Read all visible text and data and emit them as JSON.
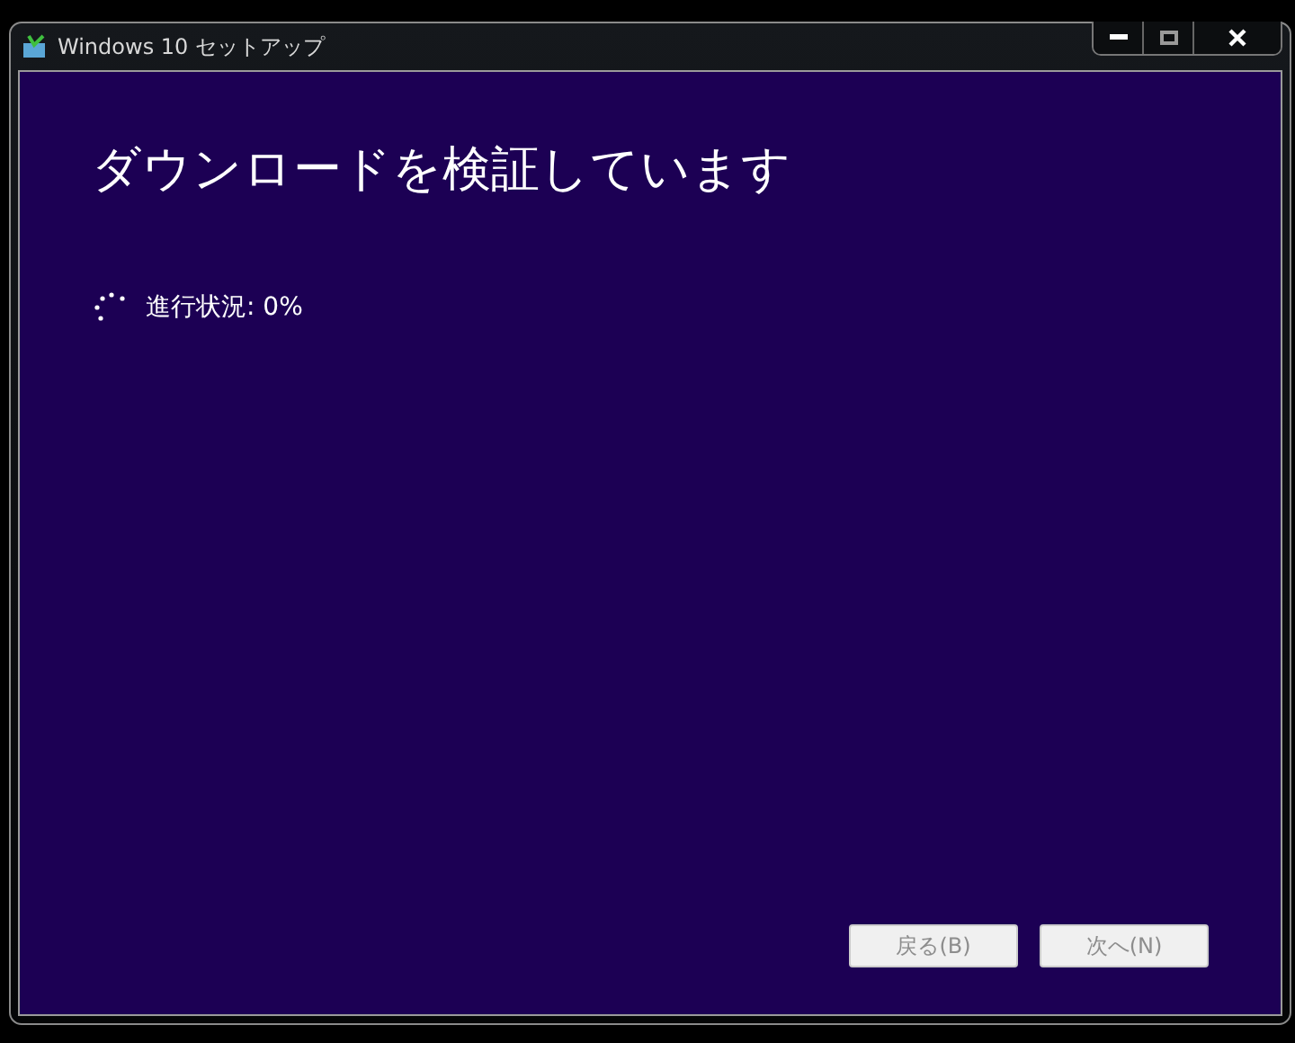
{
  "window": {
    "title": "Windows 10 セットアップ"
  },
  "heading": "ダウンロードを検証しています",
  "progress": {
    "label": "進行状況: 0%"
  },
  "buttons": [
    {
      "label": "戻る(B)",
      "disabled": true
    },
    {
      "label": "次へ(N)",
      "disabled": true
    }
  ]
}
